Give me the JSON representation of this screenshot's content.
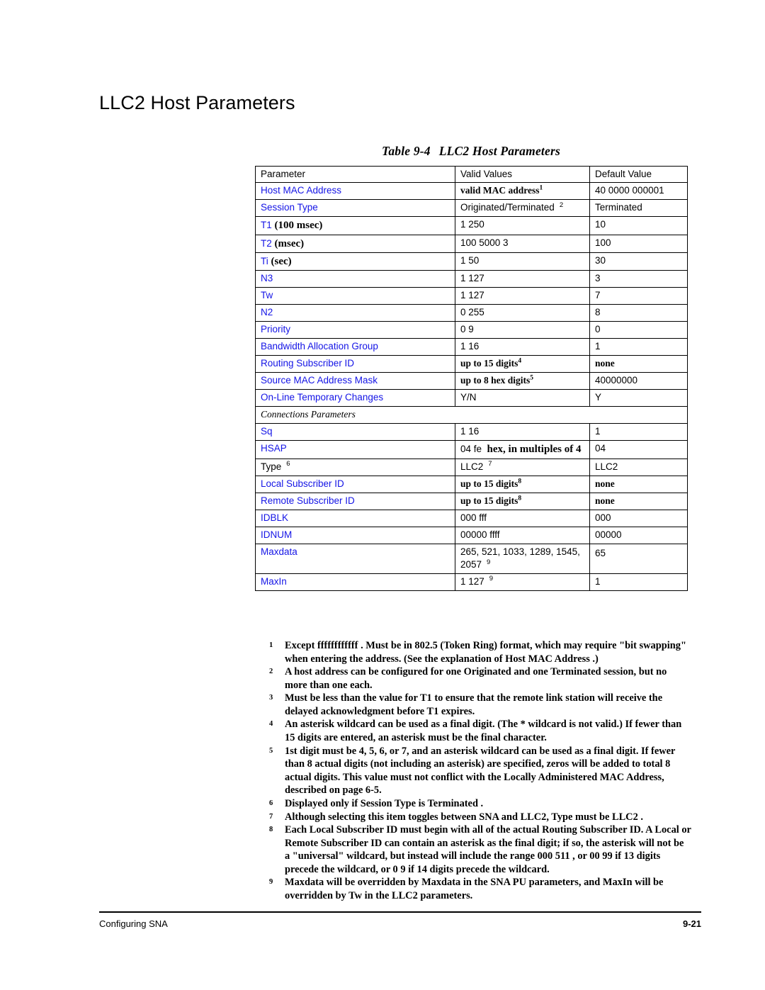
{
  "page": {
    "section_heading": "LLC2 Host Parameters",
    "caption_number": "Table 9-4",
    "caption_title": "LLC2 Host Parameters"
  },
  "table": {
    "headers": {
      "parameter": "Parameter",
      "valid_values": "Valid Values",
      "default_value": "Default Value"
    },
    "section_label": "Connections Parameters",
    "rows": [
      {
        "parameter": "Host MAC Address",
        "valid": "valid MAC address",
        "valid_sup": "1",
        "default": "40 0000 000001"
      },
      {
        "parameter": "Session Type",
        "valid": "Originated/Terminated",
        "valid_sup": "2",
        "default": "Terminated"
      },
      {
        "parameter": "T1",
        "parameter_note": "(100 msec)",
        "valid": "1 250",
        "valid_sup": "",
        "default": "10"
      },
      {
        "parameter": "T2",
        "parameter_note": "(msec)",
        "valid": "100 5000 3",
        "valid_sup": "",
        "default": "100"
      },
      {
        "parameter": "Ti",
        "parameter_note": "(sec)",
        "valid": "1 50",
        "valid_sup": "",
        "default": "30"
      },
      {
        "parameter": "N3",
        "valid": "1 127",
        "valid_sup": "",
        "default": "3"
      },
      {
        "parameter": "Tw",
        "valid": "1 127",
        "valid_sup": "",
        "default": "7"
      },
      {
        "parameter": "N2",
        "valid": "0 255",
        "valid_sup": "",
        "default": "8"
      },
      {
        "parameter": "Priority",
        "valid": "0 9",
        "valid_sup": "",
        "default": "0"
      },
      {
        "parameter": "Bandwidth Allocation Group",
        "valid": "1 16",
        "valid_sup": "",
        "default": "1"
      },
      {
        "parameter": "Routing Subscriber ID",
        "valid": "up to 15 digits",
        "valid_sup": "4",
        "default": "none"
      },
      {
        "parameter": "Source MAC Address Mask",
        "valid": "up to 8 hex digits",
        "valid_sup": "5",
        "default": "40000000"
      },
      {
        "parameter": "On-Line Temporary Changes",
        "valid": "Y/N",
        "valid_sup": "",
        "default": "Y"
      }
    ],
    "rows2": [
      {
        "parameter": "Sq",
        "valid": "1 16",
        "valid_sup": "",
        "default": "1"
      },
      {
        "parameter": "HSAP",
        "valid": "04 fe",
        "valid_extra": "hex, in multiples of 4",
        "valid_sup": "",
        "default": "04"
      },
      {
        "parameter": "Type",
        "parameter_sup": "6",
        "valid": "LLC2",
        "valid_sup": "7",
        "default": "LLC2"
      },
      {
        "parameter": "Local Subscriber ID",
        "valid": "up to 15 digits",
        "valid_sup": "8",
        "default": "none"
      },
      {
        "parameter": "Remote Subscriber ID",
        "valid": "up to 15 digits",
        "valid_sup": "8",
        "default": "none"
      },
      {
        "parameter": "IDBLK",
        "valid": "000 fff",
        "valid_sup": "",
        "default": "000"
      },
      {
        "parameter": "IDNUM",
        "valid": "00000 ffff",
        "valid_sup": "",
        "default": "00000"
      },
      {
        "parameter": "Maxdata",
        "valid": "265, 521, 1033, 1289, 1545,",
        "valid_line2": "2057",
        "valid_sup": "9",
        "default": "65"
      },
      {
        "parameter": "MaxIn",
        "valid": "1 127",
        "valid_sup": "9",
        "default": "1"
      }
    ]
  },
  "footnotes": [
    {
      "num": "1",
      "text": "Except ffffffffffff . Must be in 802.5 (Token Ring) format, which may require \"bit swapping\" when entering the address. (See the explanation of Host MAC Address .)"
    },
    {
      "num": "2",
      "text": "A host address can be configured for one Originated and one Terminated session, but no more than one each."
    },
    {
      "num": "3",
      "text": "Must be less than the value for T1 to ensure that the remote link station will receive the delayed acknowledgment before T1 expires."
    },
    {
      "num": "4",
      "text": "An asterisk wildcard can be used as a final digit. (The * wildcard is not valid.) If fewer than 15 digits are entered, an asterisk must be the final character."
    },
    {
      "num": "5",
      "text": "1st digit must be 4, 5, 6, or 7, and an asterisk wildcard can be used as a final digit. If fewer than 8 actual digits (not including an asterisk) are specified, zeros will be added to total 8 actual digits. This value must not conflict with the Locally Administered MAC Address, described on page 6-5."
    },
    {
      "num": "6",
      "text": "Displayed only if Session Type is Terminated ."
    },
    {
      "num": "7",
      "text": "Although selecting this item toggles between SNA and LLC2, Type must be LLC2 ."
    },
    {
      "num": "8",
      "text": "Each Local Subscriber ID must begin with all of the actual Routing Subscriber ID. A Local or Remote Subscriber ID can contain an asterisk as the final digit; if so, the asterisk will not be a \"universal\" wildcard, but instead will include the range 000 511 , or 00 99 if 13 digits precede the wildcard, or 0 9 if 14 digits precede the wildcard."
    },
    {
      "num": "9",
      "text": "Maxdata will be overridden by Maxdata in the SNA PU parameters, and MaxIn will be overridden by Tw in the LLC2 parameters."
    }
  ],
  "footer": {
    "left": "Configuring SNA",
    "right": "9-21"
  },
  "colors": {
    "link_blue": "#1414e6",
    "text_black": "#000000"
  }
}
